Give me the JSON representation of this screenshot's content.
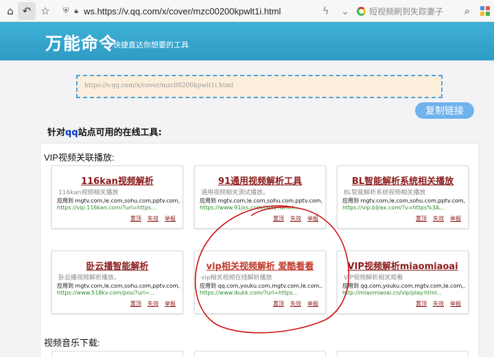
{
  "browser": {
    "url": "ws.https://v.qq.com/x/cover/mzc00200kpwlt1i.html",
    "search_text": "短视频刷到失踪妻子"
  },
  "header": {
    "title": "万能命令",
    "subtitle": "快捷直达你想要的工具"
  },
  "input": {
    "url_text": "https://v.qq.com/x/cover/mzc00200kpwlt1i.html"
  },
  "copy_label": "复制链接",
  "section": {
    "prefix": "针对",
    "site": "qq",
    "suffix": "站点可用的在线工具:"
  },
  "vip_label": "VIP视频关联播放:",
  "music_label": "视频音乐下载:",
  "actions": {
    "top": "置顶",
    "invalid": "失效",
    "report": "举报"
  },
  "cards": [
    {
      "name": "116kan视频解析",
      "desc": "116kan视频相关播放",
      "apply": "应用到 mgtv.com,le.com,sohu.com,pptv.com,...",
      "link": "https://vip.116kan.com/?url=https..."
    },
    {
      "name": "91通用视频解析工具",
      "desc": "通用视频相关测试播放。",
      "apply": "应用到 mgtv.com,le.com,sohu.com,pptv.com,...",
      "link": "https://www.91jxs.com/jiexi/?url=h..."
    },
    {
      "name": "BL智能解析系统相关播放",
      "desc": "BL智能解析系统视频相关播放",
      "apply": "应用到 mgtv.com,le.com,sohu.com,pptv.com,...",
      "link": "https://vip.bljiex.com/?v=https%3A..."
    },
    {
      "name": "卧云播智能解析",
      "desc": "卧云播视频解析播放。",
      "apply": "应用到 mgtv.com,le.com,sohu.com,pptv.com,...",
      "link": "https://www.518kv.com/pos/?url=..."
    },
    {
      "name": "vip相关视频解析 爱酷看看",
      "desc": "vip相关视频在线解析播放",
      "apply": "应用到 qq.com,youku.com,mgtv.com,le.com,...",
      "link": "https://www.ikukk.com/?url=https..."
    },
    {
      "name": "VIP视频解析miaomiaoai",
      "desc": "VIP视频解析相关观看",
      "apply": "应用到 qq.com,youku.com,mgtv.com,le.com,...",
      "link": "http://miaomiaoai.cn/vip/play.html..."
    }
  ],
  "colors": {
    "banner": "#3fb1d6",
    "card_title": "#8b1a1a",
    "link": "#2a8a2a",
    "annotation": "#cc1111"
  }
}
